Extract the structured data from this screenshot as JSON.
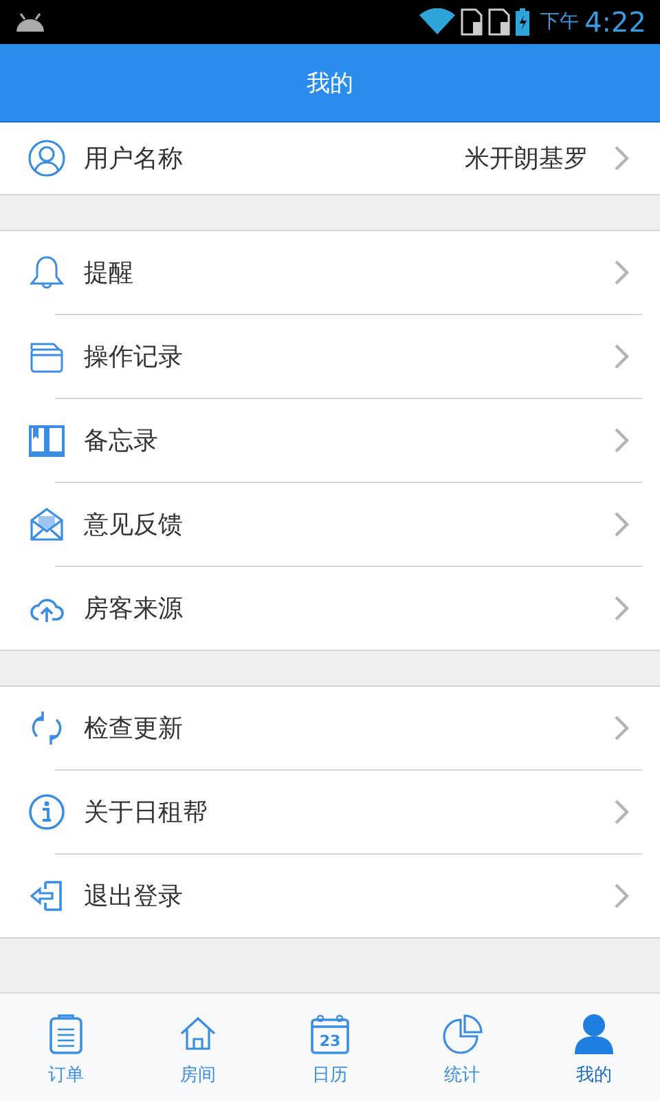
{
  "status_bar": {
    "period": "下午",
    "time": "4:22"
  },
  "header": {
    "title": "我的"
  },
  "profile": {
    "kind": "user",
    "label": "用户名称",
    "value": "米开朗基罗"
  },
  "groups": [
    [
      {
        "kind": "bell",
        "label": "提醒"
      },
      {
        "kind": "folder",
        "label": "操作记录"
      },
      {
        "kind": "book",
        "label": "备忘录"
      },
      {
        "kind": "mail",
        "label": "意见反馈"
      },
      {
        "kind": "cloud",
        "label": "房客来源"
      }
    ],
    [
      {
        "kind": "refresh",
        "label": "检查更新"
      },
      {
        "kind": "info",
        "label": "关于日租帮"
      },
      {
        "kind": "logout",
        "label": "退出登录"
      }
    ]
  ],
  "tabs": [
    {
      "kind": "clipboard",
      "label": "订单",
      "selected": false
    },
    {
      "kind": "house",
      "label": "房间",
      "selected": false
    },
    {
      "kind": "calendar",
      "label": "日历",
      "icon_text": "23",
      "selected": false
    },
    {
      "kind": "pie",
      "label": "统计",
      "selected": false
    },
    {
      "kind": "person",
      "label": "我的",
      "selected": true
    }
  ]
}
